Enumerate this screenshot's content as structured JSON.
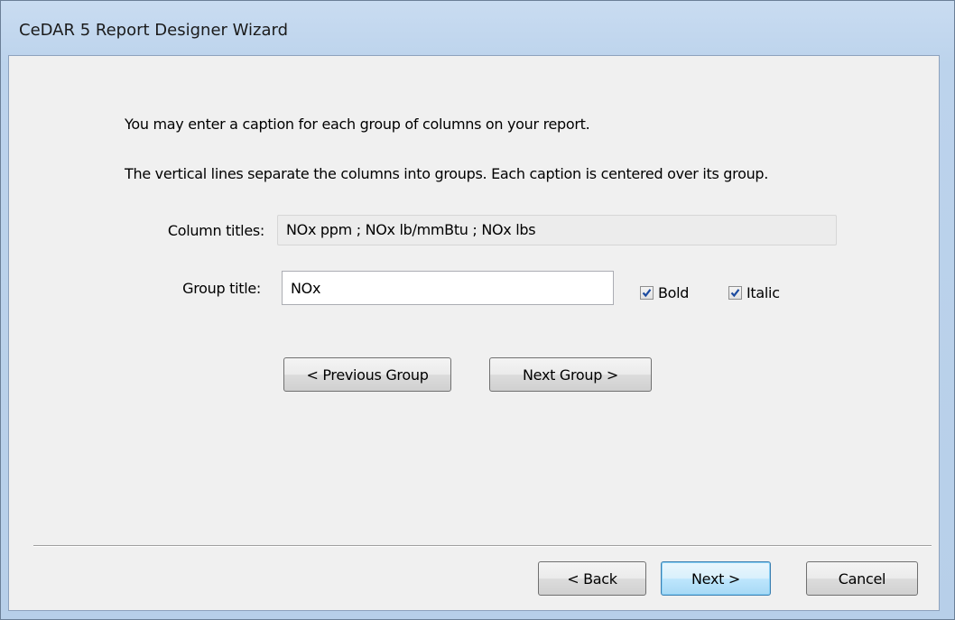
{
  "window": {
    "title": "CeDAR 5 Report Designer Wizard"
  },
  "instructions": {
    "line1": "You may enter a caption for each group of columns on your report.",
    "line2": "The vertical lines separate the columns into groups. Each caption is centered over its group."
  },
  "form": {
    "column_titles_label": "Column titles:",
    "column_titles_value": "NOx ppm ;  NOx lb/mmBtu ;  NOx lbs",
    "group_title_label": "Group title:",
    "group_title_value": "NOx",
    "bold": {
      "label": "Bold",
      "checked": true
    },
    "italic": {
      "label": "Italic",
      "checked": true
    }
  },
  "group_nav": {
    "previous_label": "< Previous Group",
    "next_label": "Next Group >"
  },
  "footer": {
    "back_label": "< Back",
    "next_label": "Next >",
    "cancel_label": "Cancel"
  },
  "colors": {
    "title_bar": "#bcd3ec",
    "client_bg": "#f0f0f0",
    "checkmark": "#1c4ba0",
    "default_button_border": "#3c7fb1"
  }
}
